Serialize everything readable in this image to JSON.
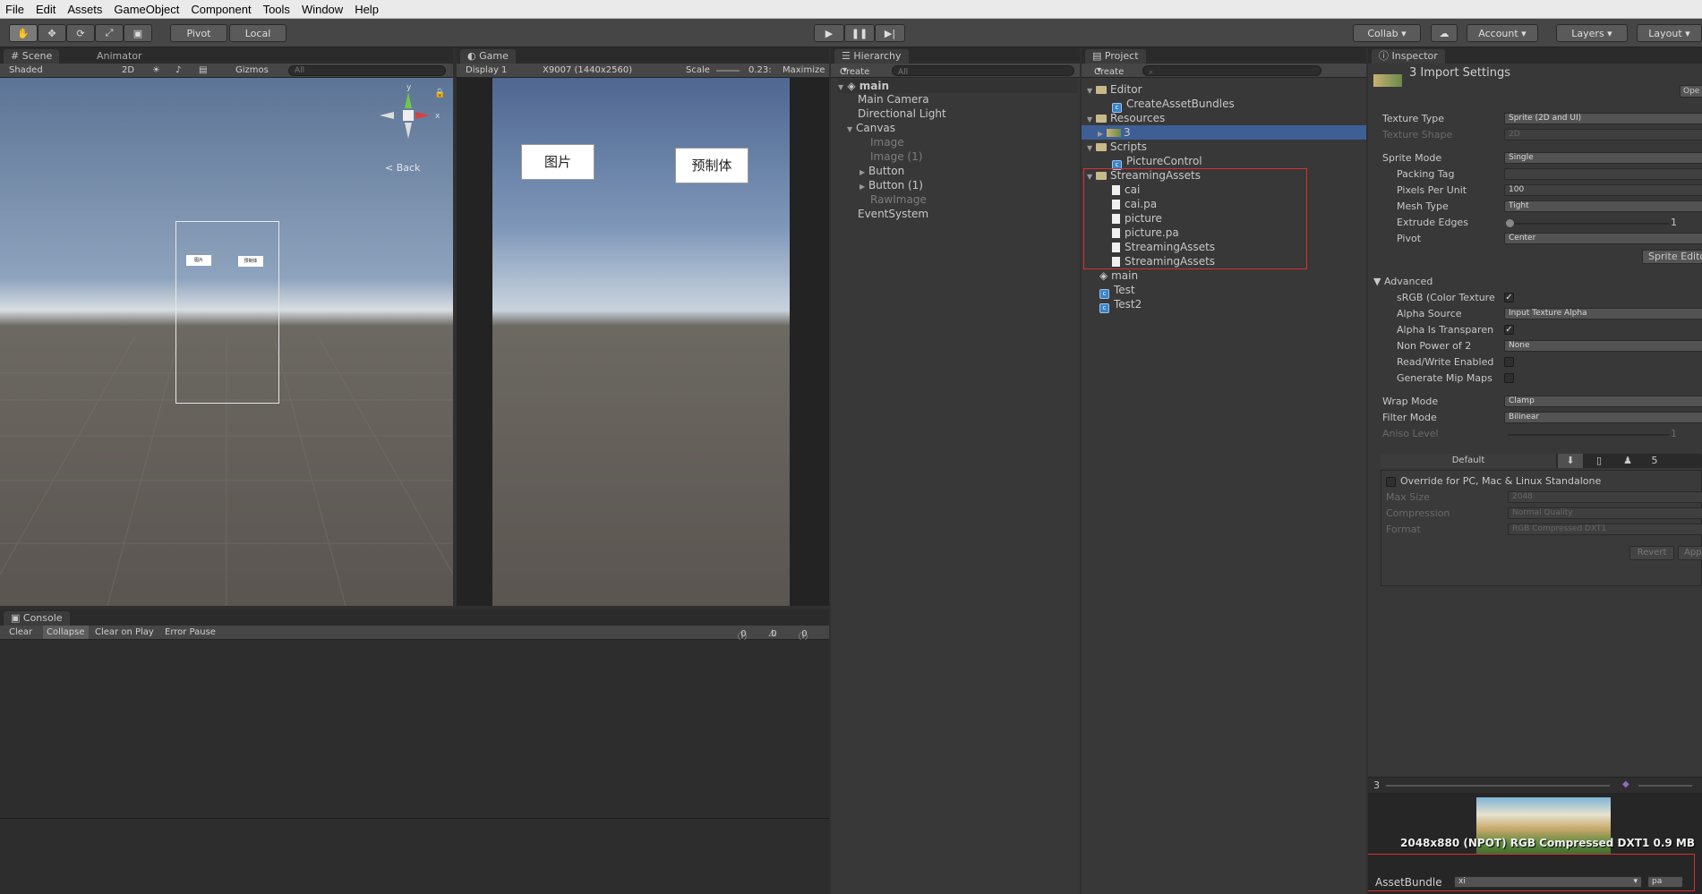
{
  "menu": [
    "File",
    "Edit",
    "Assets",
    "GameObject",
    "Component",
    "Tools",
    "Window",
    "Help"
  ],
  "toolbar": {
    "pivot": "Pivot",
    "local": "Local",
    "collab": "Collab",
    "account": "Account",
    "layers": "Layers",
    "layout": "Layout"
  },
  "scene": {
    "tab": "Scene",
    "animator_tab": "Animator",
    "shading": "Shaded",
    "mode2d": "2D",
    "gizmos": "Gizmos",
    "search_placeholder": "All",
    "back": "Back",
    "mini_btn1": "图片",
    "mini_btn2": "预制体",
    "gizmo_y": "y",
    "gizmo_x": "x"
  },
  "game": {
    "tab": "Game",
    "display": "Display 1",
    "resolution": "X9007 (1440x2560)",
    "scale_label": "Scale",
    "scale_value": "0.23:",
    "maximize": "Maximize",
    "button1": "图片",
    "button2": "预制体"
  },
  "hierarchy": {
    "tab": "Hierarchy",
    "create": "Create",
    "search_placeholder": "All",
    "scene": "main",
    "items": [
      {
        "label": "Main Camera"
      },
      {
        "label": "Directional Light"
      },
      {
        "label": "Canvas"
      },
      {
        "label": "Image"
      },
      {
        "label": "Image (1)"
      },
      {
        "label": "Button"
      },
      {
        "label": "Button (1)"
      },
      {
        "label": "RawImage"
      },
      {
        "label": "EventSystem"
      }
    ]
  },
  "project": {
    "tab": "Project",
    "create": "Create",
    "items": [
      {
        "label": "Editor"
      },
      {
        "label": "CreateAssetBundles"
      },
      {
        "label": "Resources"
      },
      {
        "label": "3"
      },
      {
        "label": "Scripts"
      },
      {
        "label": "PictureControl"
      },
      {
        "label": "StreamingAssets"
      },
      {
        "label": "cai"
      },
      {
        "label": "cai.pa"
      },
      {
        "label": "picture"
      },
      {
        "label": "picture.pa"
      },
      {
        "label": "StreamingAssets"
      },
      {
        "label": "StreamingAssets"
      },
      {
        "label": "main"
      },
      {
        "label": "Test"
      },
      {
        "label": "Test2"
      }
    ]
  },
  "inspector": {
    "tab": "Inspector",
    "title": "3 Import Settings",
    "open": "Ope",
    "texture_type_label": "Texture Type",
    "texture_type": "Sprite (2D and UI)",
    "texture_shape_label": "Texture Shape",
    "texture_shape": "2D",
    "sprite_mode_label": "Sprite Mode",
    "sprite_mode": "Single",
    "packing_tag_label": "Packing Tag",
    "packing_tag": "",
    "ppu_label": "Pixels Per Unit",
    "ppu": "100",
    "mesh_type_label": "Mesh Type",
    "mesh_type": "Tight",
    "extrude_label": "Extrude Edges",
    "extrude": "1",
    "pivot_label": "Pivot",
    "pivot": "Center",
    "sprite_editor": "Sprite Edito",
    "advanced": "Advanced",
    "srgb_label": "sRGB (Color Texture",
    "alpha_source_label": "Alpha Source",
    "alpha_source": "Input Texture Alpha",
    "alpha_transp_label": "Alpha Is Transparen",
    "npot_label": "Non Power of 2",
    "npot": "None",
    "rw_label": "Read/Write Enabled",
    "mip_label": "Generate Mip Maps",
    "wrap_label": "Wrap Mode",
    "wrap": "Clamp",
    "filter_label": "Filter Mode",
    "filter": "Bilinear",
    "aniso_label": "Aniso Level",
    "aniso": "1",
    "platform_default": "Default",
    "override_label": "Override for PC, Mac & Linux Standalone",
    "max_size_label": "Max Size",
    "max_size": "2048",
    "compression_label": "Compression",
    "compression": "Normal Quality",
    "format_label": "Format",
    "format": "RGB Compressed DXT1",
    "revert": "Revert",
    "apply": "App",
    "preview_name": "3",
    "preview_info": "2048x880 (NPOT)  RGB Compressed DXT1   0.9 MB",
    "assetbundle_label": "AssetBundle",
    "assetbundle_value": "xi",
    "assetbundle_variant": "pa"
  },
  "console": {
    "tab": "Console",
    "clear": "Clear",
    "collapse": "Collapse",
    "clear_on_play": "Clear on Play",
    "error_pause": "Error Pause",
    "count_info": "0",
    "count_warn": "0",
    "count_error": "0"
  }
}
